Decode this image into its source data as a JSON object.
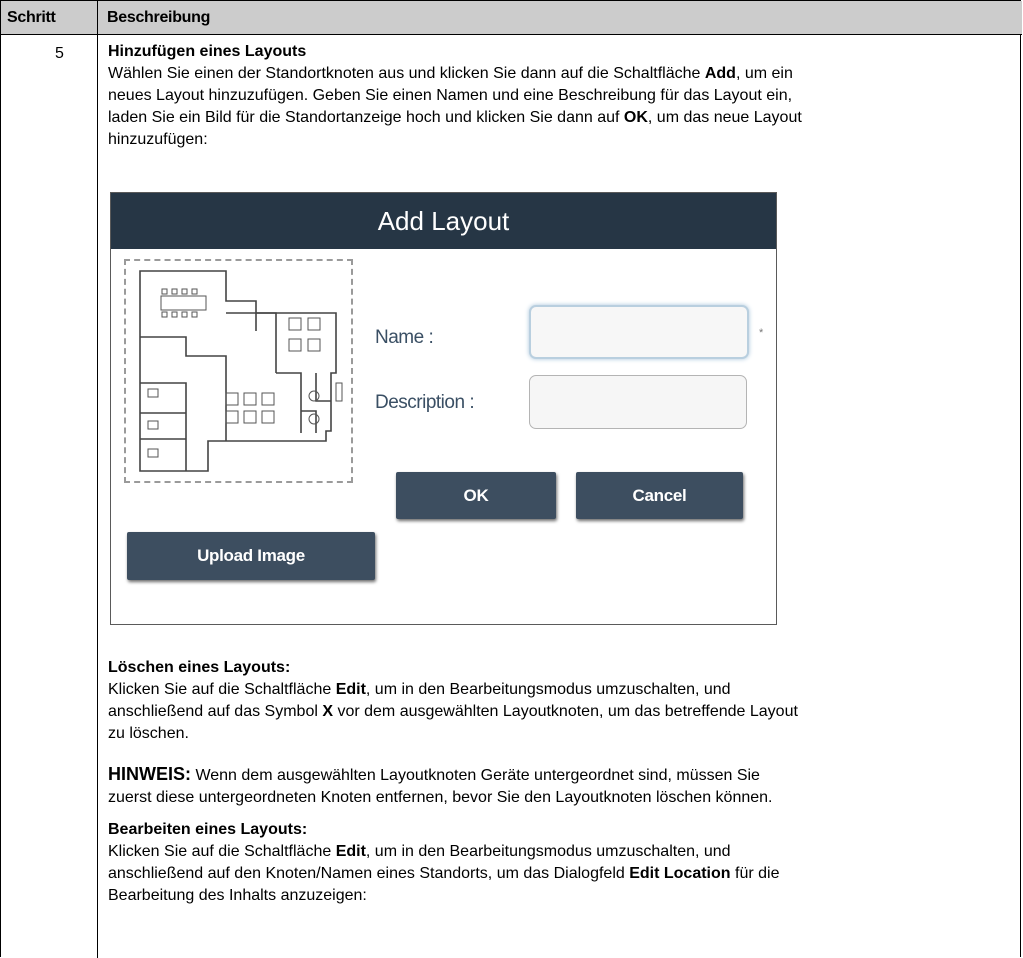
{
  "table": {
    "header_step": "Schritt",
    "header_desc": "Beschreibung",
    "step_number": "5"
  },
  "content": {
    "heading1": "Hinzufügen eines Layouts",
    "para1_line1_a": "Wählen Sie einen der Standortknoten aus und klicken Sie dann auf die Schaltfläche ",
    "para1_line1_b": "Add",
    "para1_line1_c": ", um ein",
    "para1_line2": "neues Layout hinzuzufügen. Geben Sie einen Namen und eine Beschreibung für das Layout ein,",
    "para1_line3_a": "laden Sie ein Bild für die Standortanzeige hoch und klicken Sie dann auf ",
    "para1_line3_b": "OK",
    "para1_line3_c": ", um das neue Layout",
    "para1_line4": "hinzuzufügen:",
    "heading2": "Löschen eines Layouts:",
    "para2_line1_a": "Klicken Sie auf die Schaltfläche ",
    "para2_line1_b": "Edit",
    "para2_line1_c": ", um in den Bearbeitungsmodus umzuschalten, und",
    "para2_line2_a": "anschließend auf das Symbol ",
    "para2_line2_b": "X",
    "para2_line2_c": " vor dem ausgewählten Layoutknoten, um das betreffende Layout",
    "para2_line3": "zu löschen.",
    "note_label": "HINWEIS:",
    "note_line1": " Wenn dem ausgewählten Layoutknoten Geräte untergeordnet sind, müssen Sie",
    "note_line2": "zuerst diese untergeordneten Knoten entfernen, bevor Sie den Layoutknoten löschen können.",
    "heading3": "Bearbeiten eines Layouts:",
    "para3_line1_a": "Klicken Sie auf die Schaltfläche ",
    "para3_line1_b": "Edit",
    "para3_line1_c": ", um in den Bearbeitungsmodus umzuschalten, und",
    "para3_line2_a": "anschließend auf den Knoten/Namen eines Standorts, um das Dialogfeld ",
    "para3_line2_b": "Edit Location",
    "para3_line2_c": " für die",
    "para3_line3": "Bearbeitung des Inhalts anzuzeigen:"
  },
  "dialog": {
    "title": "Add Layout",
    "name_label": "Name :",
    "description_label": "Description :",
    "required_marker": "*",
    "ok_label": "OK",
    "cancel_label": "Cancel",
    "upload_label": "Upload Image"
  },
  "colors": {
    "header_bg": "#cccccc",
    "dialog_title_bg": "#263645",
    "button_bg": "#3d4e60",
    "label_color": "#3a4f64"
  }
}
